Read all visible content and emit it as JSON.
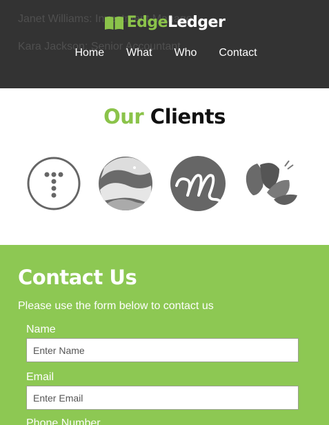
{
  "header": {
    "bg_color": "#333333",
    "ghost_lines": [
      "Janet Williams: Investment Manager",
      "Kara Jackson: Senior Accountant"
    ],
    "logo": {
      "icon": "open-book-icon",
      "part1": "Edge",
      "part2": "Ledger",
      "accent": "#8bc34a"
    },
    "nav": [
      {
        "label": "Home"
      },
      {
        "label": "What"
      },
      {
        "label": "Who"
      },
      {
        "label": "Contact"
      }
    ]
  },
  "clients": {
    "title_part1": "Our",
    "title_part2": "Clients",
    "logos": [
      {
        "icon": "t-dots-circle-logo-icon"
      },
      {
        "icon": "swirl-sphere-logo-icon"
      },
      {
        "icon": "script-m-circle-logo-icon"
      },
      {
        "icon": "leaves-logo-icon"
      }
    ]
  },
  "contact": {
    "bg_color": "#8dc853",
    "title": "Contact Us",
    "subtitle": "Please use the form below to contact us",
    "fields": [
      {
        "label": "Name",
        "placeholder": "Enter Name"
      },
      {
        "label": "Email",
        "placeholder": "Enter Email"
      },
      {
        "label": "Phone Number"
      }
    ]
  }
}
